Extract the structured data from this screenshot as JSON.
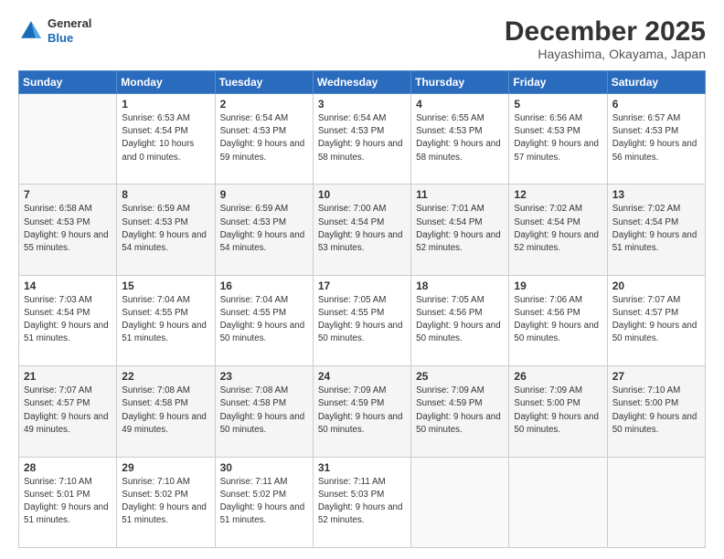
{
  "header": {
    "logo": {
      "general": "General",
      "blue": "Blue"
    },
    "title": "December 2025",
    "subtitle": "Hayashima, Okayama, Japan"
  },
  "days_of_week": [
    "Sunday",
    "Monday",
    "Tuesday",
    "Wednesday",
    "Thursday",
    "Friday",
    "Saturday"
  ],
  "weeks": [
    [
      {
        "day": "",
        "sunrise": "",
        "sunset": "",
        "daylight": "",
        "empty": true
      },
      {
        "day": "1",
        "sunrise": "Sunrise: 6:53 AM",
        "sunset": "Sunset: 4:54 PM",
        "daylight": "Daylight: 10 hours and 0 minutes."
      },
      {
        "day": "2",
        "sunrise": "Sunrise: 6:54 AM",
        "sunset": "Sunset: 4:53 PM",
        "daylight": "Daylight: 9 hours and 59 minutes."
      },
      {
        "day": "3",
        "sunrise": "Sunrise: 6:54 AM",
        "sunset": "Sunset: 4:53 PM",
        "daylight": "Daylight: 9 hours and 58 minutes."
      },
      {
        "day": "4",
        "sunrise": "Sunrise: 6:55 AM",
        "sunset": "Sunset: 4:53 PM",
        "daylight": "Daylight: 9 hours and 58 minutes."
      },
      {
        "day": "5",
        "sunrise": "Sunrise: 6:56 AM",
        "sunset": "Sunset: 4:53 PM",
        "daylight": "Daylight: 9 hours and 57 minutes."
      },
      {
        "day": "6",
        "sunrise": "Sunrise: 6:57 AM",
        "sunset": "Sunset: 4:53 PM",
        "daylight": "Daylight: 9 hours and 56 minutes."
      }
    ],
    [
      {
        "day": "7",
        "sunrise": "Sunrise: 6:58 AM",
        "sunset": "Sunset: 4:53 PM",
        "daylight": "Daylight: 9 hours and 55 minutes."
      },
      {
        "day": "8",
        "sunrise": "Sunrise: 6:59 AM",
        "sunset": "Sunset: 4:53 PM",
        "daylight": "Daylight: 9 hours and 54 minutes."
      },
      {
        "day": "9",
        "sunrise": "Sunrise: 6:59 AM",
        "sunset": "Sunset: 4:53 PM",
        "daylight": "Daylight: 9 hours and 54 minutes."
      },
      {
        "day": "10",
        "sunrise": "Sunrise: 7:00 AM",
        "sunset": "Sunset: 4:54 PM",
        "daylight": "Daylight: 9 hours and 53 minutes."
      },
      {
        "day": "11",
        "sunrise": "Sunrise: 7:01 AM",
        "sunset": "Sunset: 4:54 PM",
        "daylight": "Daylight: 9 hours and 52 minutes."
      },
      {
        "day": "12",
        "sunrise": "Sunrise: 7:02 AM",
        "sunset": "Sunset: 4:54 PM",
        "daylight": "Daylight: 9 hours and 52 minutes."
      },
      {
        "day": "13",
        "sunrise": "Sunrise: 7:02 AM",
        "sunset": "Sunset: 4:54 PM",
        "daylight": "Daylight: 9 hours and 51 minutes."
      }
    ],
    [
      {
        "day": "14",
        "sunrise": "Sunrise: 7:03 AM",
        "sunset": "Sunset: 4:54 PM",
        "daylight": "Daylight: 9 hours and 51 minutes."
      },
      {
        "day": "15",
        "sunrise": "Sunrise: 7:04 AM",
        "sunset": "Sunset: 4:55 PM",
        "daylight": "Daylight: 9 hours and 51 minutes."
      },
      {
        "day": "16",
        "sunrise": "Sunrise: 7:04 AM",
        "sunset": "Sunset: 4:55 PM",
        "daylight": "Daylight: 9 hours and 50 minutes."
      },
      {
        "day": "17",
        "sunrise": "Sunrise: 7:05 AM",
        "sunset": "Sunset: 4:55 PM",
        "daylight": "Daylight: 9 hours and 50 minutes."
      },
      {
        "day": "18",
        "sunrise": "Sunrise: 7:05 AM",
        "sunset": "Sunset: 4:56 PM",
        "daylight": "Daylight: 9 hours and 50 minutes."
      },
      {
        "day": "19",
        "sunrise": "Sunrise: 7:06 AM",
        "sunset": "Sunset: 4:56 PM",
        "daylight": "Daylight: 9 hours and 50 minutes."
      },
      {
        "day": "20",
        "sunrise": "Sunrise: 7:07 AM",
        "sunset": "Sunset: 4:57 PM",
        "daylight": "Daylight: 9 hours and 50 minutes."
      }
    ],
    [
      {
        "day": "21",
        "sunrise": "Sunrise: 7:07 AM",
        "sunset": "Sunset: 4:57 PM",
        "daylight": "Daylight: 9 hours and 49 minutes."
      },
      {
        "day": "22",
        "sunrise": "Sunrise: 7:08 AM",
        "sunset": "Sunset: 4:58 PM",
        "daylight": "Daylight: 9 hours and 49 minutes."
      },
      {
        "day": "23",
        "sunrise": "Sunrise: 7:08 AM",
        "sunset": "Sunset: 4:58 PM",
        "daylight": "Daylight: 9 hours and 50 minutes."
      },
      {
        "day": "24",
        "sunrise": "Sunrise: 7:09 AM",
        "sunset": "Sunset: 4:59 PM",
        "daylight": "Daylight: 9 hours and 50 minutes."
      },
      {
        "day": "25",
        "sunrise": "Sunrise: 7:09 AM",
        "sunset": "Sunset: 4:59 PM",
        "daylight": "Daylight: 9 hours and 50 minutes."
      },
      {
        "day": "26",
        "sunrise": "Sunrise: 7:09 AM",
        "sunset": "Sunset: 5:00 PM",
        "daylight": "Daylight: 9 hours and 50 minutes."
      },
      {
        "day": "27",
        "sunrise": "Sunrise: 7:10 AM",
        "sunset": "Sunset: 5:00 PM",
        "daylight": "Daylight: 9 hours and 50 minutes."
      }
    ],
    [
      {
        "day": "28",
        "sunrise": "Sunrise: 7:10 AM",
        "sunset": "Sunset: 5:01 PM",
        "daylight": "Daylight: 9 hours and 51 minutes."
      },
      {
        "day": "29",
        "sunrise": "Sunrise: 7:10 AM",
        "sunset": "Sunset: 5:02 PM",
        "daylight": "Daylight: 9 hours and 51 minutes."
      },
      {
        "day": "30",
        "sunrise": "Sunrise: 7:11 AM",
        "sunset": "Sunset: 5:02 PM",
        "daylight": "Daylight: 9 hours and 51 minutes."
      },
      {
        "day": "31",
        "sunrise": "Sunrise: 7:11 AM",
        "sunset": "Sunset: 5:03 PM",
        "daylight": "Daylight: 9 hours and 52 minutes."
      },
      {
        "day": "",
        "sunrise": "",
        "sunset": "",
        "daylight": "",
        "empty": true
      },
      {
        "day": "",
        "sunrise": "",
        "sunset": "",
        "daylight": "",
        "empty": true
      },
      {
        "day": "",
        "sunrise": "",
        "sunset": "",
        "daylight": "",
        "empty": true
      }
    ]
  ]
}
